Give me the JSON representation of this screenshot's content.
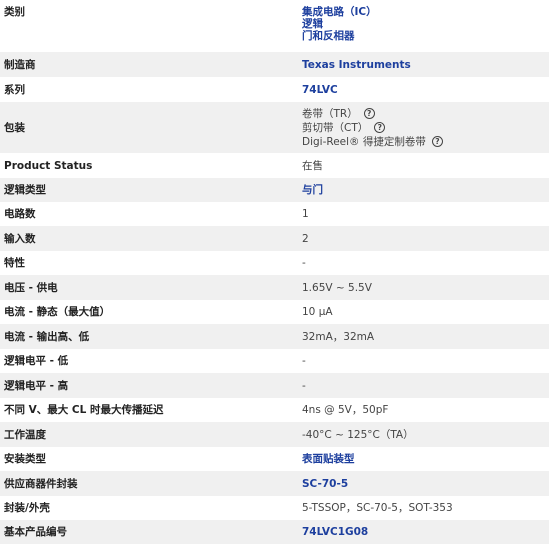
{
  "rows": [
    {
      "label": "类别",
      "links": [
        "集成电路（IC）",
        "逻辑",
        "门和反相器"
      ]
    },
    {
      "label": "制造商",
      "link": "Texas Instruments"
    },
    {
      "label": "系列",
      "link": "74LVC"
    },
    {
      "label": "包装",
      "packaging": [
        "卷带（TR）",
        "剪切带（CT）",
        "Digi-Reel® 得捷定制卷带"
      ]
    },
    {
      "label": "Product Status",
      "value": "在售"
    },
    {
      "label": "逻辑类型",
      "link": "与门"
    },
    {
      "label": "电路数",
      "value": "1"
    },
    {
      "label": "输入数",
      "value": "2"
    },
    {
      "label": "特性",
      "value": "-"
    },
    {
      "label": "电压 - 供电",
      "value": "1.65V ~ 5.5V"
    },
    {
      "label": "电流 - 静态（最大值）",
      "value": "10 µA"
    },
    {
      "label": "电流 - 输出高、低",
      "value": "32mA，32mA"
    },
    {
      "label": "逻辑电平 - 低",
      "value": "-"
    },
    {
      "label": "逻辑电平 - 高",
      "value": "-"
    },
    {
      "label": "不同 V、最大 CL 时最大传播延迟",
      "value": "4ns @ 5V，50pF"
    },
    {
      "label": "工作温度",
      "value": "-40°C ~ 125°C（TA）"
    },
    {
      "label": "安装类型",
      "link": "表面贴装型"
    },
    {
      "label": "供应商器件封装",
      "link": "SC-70-5"
    },
    {
      "label": "封装/外壳",
      "value": "5-TSSOP，SC-70-5，SOT-353"
    },
    {
      "label": "基本产品编号",
      "link": "74LVC1G08"
    }
  ],
  "help_icon": "question-circle-icon"
}
